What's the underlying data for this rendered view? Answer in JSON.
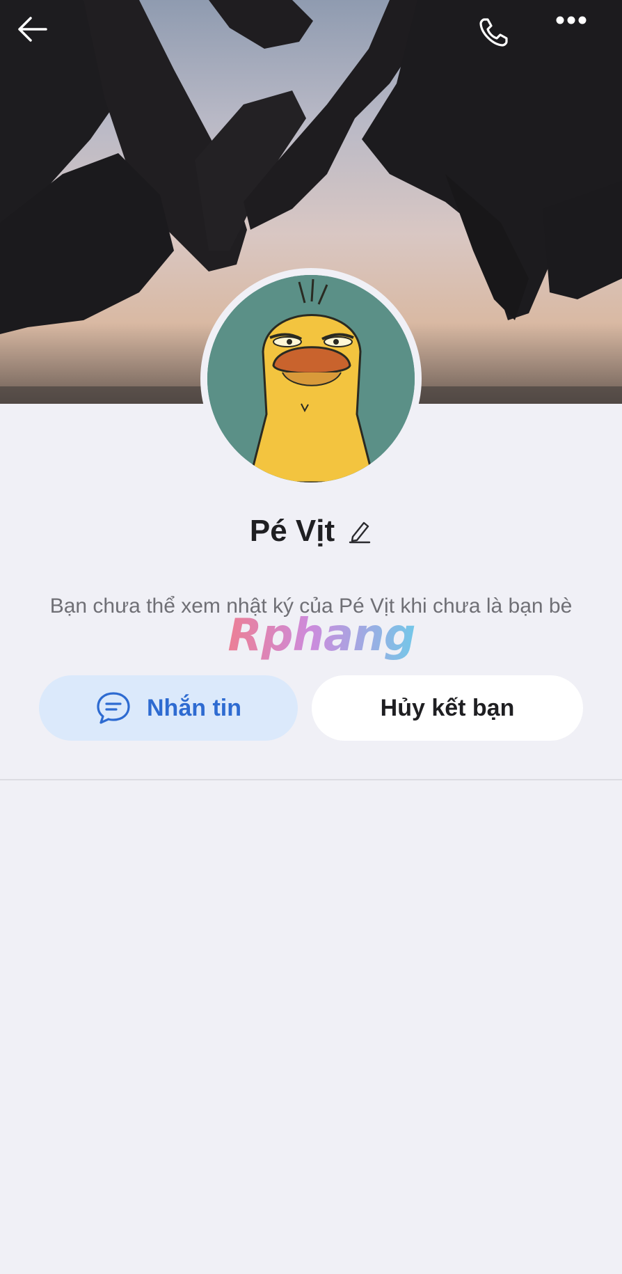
{
  "header": {
    "back_icon": "arrow-left-icon",
    "call_icon": "phone-icon",
    "more_icon": "more-horizontal-icon"
  },
  "profile": {
    "name": "Pé Vịt",
    "edit_icon": "pencil-icon",
    "description": "Bạn chưa thể xem nhật ký của Pé Vịt khi chưa là bạn bè"
  },
  "actions": {
    "message_label": "Nhắn tin",
    "message_icon": "chat-bubble-icon",
    "unfriend_label": "Hủy kết bạn"
  },
  "watermark": {
    "text": "Rphang"
  },
  "colors": {
    "background": "#f0f0f6",
    "message_button_bg": "#dbe9fb",
    "message_button_text": "#2e6bd1",
    "name_text": "#1f1f22"
  }
}
